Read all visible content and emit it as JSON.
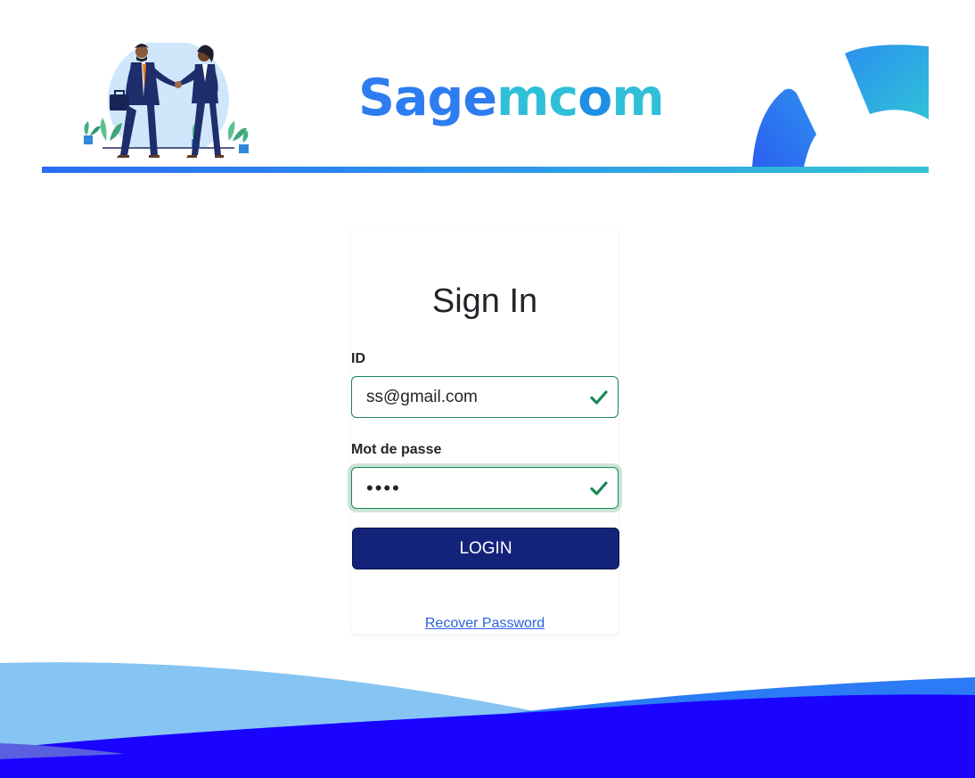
{
  "header": {
    "brand": {
      "part_a": "Sage",
      "part_b": "mc",
      "part_c": "o",
      "part_d": "m"
    },
    "illustration_icon": "handshake-illustration",
    "colors": {
      "bar_start": "#2a6cf5",
      "bar_end": "#33c4d4"
    }
  },
  "login": {
    "title": "Sign In",
    "id_label": "ID",
    "id_value": "ss@gmail.com",
    "password_label": "Mot de passe",
    "password_value": "ssss",
    "valid_icon": "check-icon",
    "login_button": "LOGIN",
    "recover_link": "Recover Password"
  },
  "colors": {
    "button": "#14237a",
    "valid": "#198754",
    "link": "#2b63e0",
    "wave_light": "#86c4f3",
    "wave_dark": "#1a03ff"
  }
}
